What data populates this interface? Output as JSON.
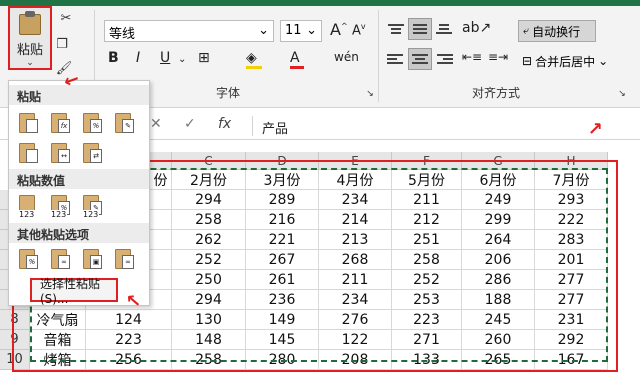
{
  "ribbon": {
    "paste_label": "粘贴",
    "font_name": "等线",
    "font_size": "11",
    "font_group_label": "字体",
    "align_group_label": "对齐方式",
    "wrap_text_label": "自动换行",
    "merge_center_label": "合并后居中",
    "bold": "B",
    "italic": "I",
    "underline": "U",
    "grow_font": "A",
    "shrink_font": "A",
    "text_color_letter": "A"
  },
  "formula_bar": {
    "fx": "fx",
    "content": "产品"
  },
  "paste_menu": {
    "section_paste": "粘贴",
    "section_values": "粘贴数值",
    "section_other": "其他粘贴选项",
    "paste_special": "选择性粘贴(S)..."
  },
  "sheet": {
    "columns": [
      "C",
      "D",
      "E",
      "F",
      "G",
      "H"
    ],
    "header_row": [
      "2月份",
      "3月份",
      "4月份",
      "5月份",
      "6月份",
      "7月份"
    ],
    "partial_header": "份",
    "rows": [
      {
        "num": "",
        "product": "",
        "b": "",
        "vals": [
          "294",
          "289",
          "234",
          "211",
          "249",
          "293"
        ]
      },
      {
        "num": "",
        "product": "",
        "b": "",
        "vals": [
          "258",
          "216",
          "214",
          "212",
          "299",
          "222"
        ]
      },
      {
        "num": "",
        "product": "",
        "b": "",
        "vals": [
          "262",
          "221",
          "213",
          "251",
          "264",
          "283"
        ]
      },
      {
        "num": "",
        "product": "",
        "b": "",
        "vals": [
          "252",
          "267",
          "268",
          "258",
          "206",
          "201"
        ]
      },
      {
        "num": "",
        "product": "",
        "b": "",
        "vals": [
          "250",
          "261",
          "211",
          "252",
          "286",
          "277"
        ]
      },
      {
        "num": "",
        "product": "",
        "b": "",
        "vals": [
          "294",
          "236",
          "234",
          "253",
          "188",
          "277"
        ]
      },
      {
        "num": "8",
        "product": "冷气扇",
        "b": "124",
        "vals": [
          "130",
          "149",
          "276",
          "223",
          "245",
          "231"
        ]
      },
      {
        "num": "9",
        "product": "音箱",
        "b": "223",
        "vals": [
          "148",
          "145",
          "122",
          "271",
          "260",
          "292"
        ]
      },
      {
        "num": "10",
        "product": "烤箱",
        "b": "256",
        "vals": [
          "258",
          "280",
          "208",
          "133",
          "265",
          "167"
        ]
      }
    ]
  }
}
